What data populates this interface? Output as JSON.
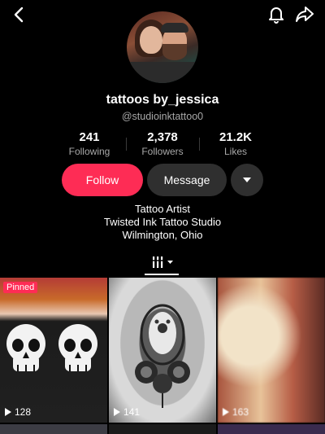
{
  "profile": {
    "username": "tattoos by_jessica",
    "handle": "@studioinktattoo0",
    "stats": [
      {
        "value": "241",
        "label": "Following"
      },
      {
        "value": "2,378",
        "label": "Followers"
      },
      {
        "value": "21.2K",
        "label": "Likes"
      }
    ],
    "bio": [
      "Tattoo Artist",
      "Twisted Ink Tattoo Studio",
      "Wilmington, Ohio"
    ]
  },
  "actions": {
    "follow_label": "Follow",
    "message_label": "Message"
  },
  "icons": {
    "back": "chevron-left-icon",
    "bell": "bell-icon",
    "share": "share-arrow-icon",
    "more": "caret-down-icon",
    "grid_tab": "grid-columns-icon"
  },
  "colors": {
    "accent": "#fe2c55",
    "button_secondary": "#2f2f2f"
  },
  "videos": [
    {
      "badge": "Pinned",
      "views": "128"
    },
    {
      "views": "141"
    },
    {
      "views": "163"
    }
  ]
}
